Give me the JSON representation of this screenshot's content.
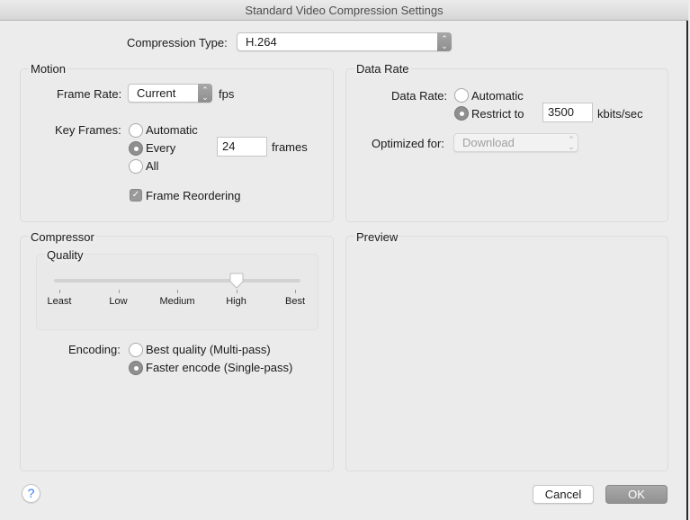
{
  "window": {
    "title": "Standard Video Compression Settings"
  },
  "compression": {
    "label": "Compression Type:",
    "value": "H.264"
  },
  "motion": {
    "title": "Motion",
    "frame_rate_label": "Frame Rate:",
    "frame_rate_value": "Current",
    "frame_rate_unit": "fps",
    "key_frames_label": "Key Frames:",
    "key_frames_options": [
      {
        "label": "Automatic",
        "selected": false
      },
      {
        "label": "Every",
        "selected": true
      },
      {
        "label": "All",
        "selected": false
      }
    ],
    "key_frames_every_value": "24",
    "key_frames_unit": "frames",
    "frame_reordering_label": "Frame Reordering",
    "frame_reordering_checked": true
  },
  "data_rate": {
    "title": "Data Rate",
    "label": "Data Rate:",
    "options": [
      {
        "label": "Automatic",
        "selected": false
      },
      {
        "label": "Restrict to",
        "selected": true
      }
    ],
    "restrict_value": "3500",
    "unit": "kbits/sec",
    "optimized_label": "Optimized for:",
    "optimized_value": "Download"
  },
  "compressor": {
    "title": "Compressor",
    "quality_title": "Quality",
    "quality_levels": [
      "Least",
      "Low",
      "Medium",
      "High",
      "Best"
    ],
    "quality_selected": "High",
    "quality_fraction": 0.75,
    "encoding_label": "Encoding:",
    "encoding_options": [
      {
        "label": "Best quality (Multi-pass)",
        "selected": false
      },
      {
        "label": "Faster encode (Single-pass)",
        "selected": true
      }
    ]
  },
  "preview": {
    "title": "Preview"
  },
  "footer": {
    "help_label": "?",
    "cancel_label": "Cancel",
    "ok_label": "OK"
  },
  "icons": {
    "popup_arrows": "⌃⌄",
    "checkmark": "✓"
  }
}
